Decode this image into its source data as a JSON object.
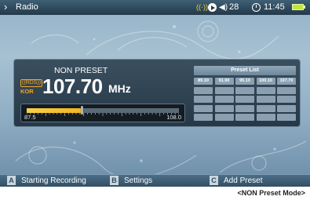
{
  "status_bar": {
    "back_glyph": "›",
    "title": "Radio",
    "signal_glyph": "((·))",
    "volume_value": "28",
    "time": "11:45"
  },
  "radio": {
    "mode_label": "NON PRESET",
    "rds_badge": "((RDS))",
    "region": "KOR",
    "frequency": "107.70",
    "unit": "MHz",
    "tuner": {
      "min_label": "87.5",
      "max_label": "108.0",
      "position_fraction": 0.36
    }
  },
  "preset_list": {
    "title": "Preset List",
    "items": [
      "89.10",
      "91.90",
      "95.10",
      "100.10",
      "107.70",
      "",
      "",
      "",
      "",
      "",
      "",
      "",
      "",
      "",
      "",
      "",
      "",
      "",
      "",
      "",
      "",
      "",
      "",
      "",
      ""
    ]
  },
  "softkeys": [
    {
      "key": "A",
      "label": "Starting Recording"
    },
    {
      "key": "B",
      "label": "Settings"
    },
    {
      "key": "C",
      "label": "Add Preset"
    }
  ],
  "caption": "<NON Preset Mode>",
  "colors": {
    "accent_orange": "#f5a623",
    "tuner_fill": "#f2b520",
    "battery": "#c4e43c",
    "status_bar": "#23394a"
  }
}
